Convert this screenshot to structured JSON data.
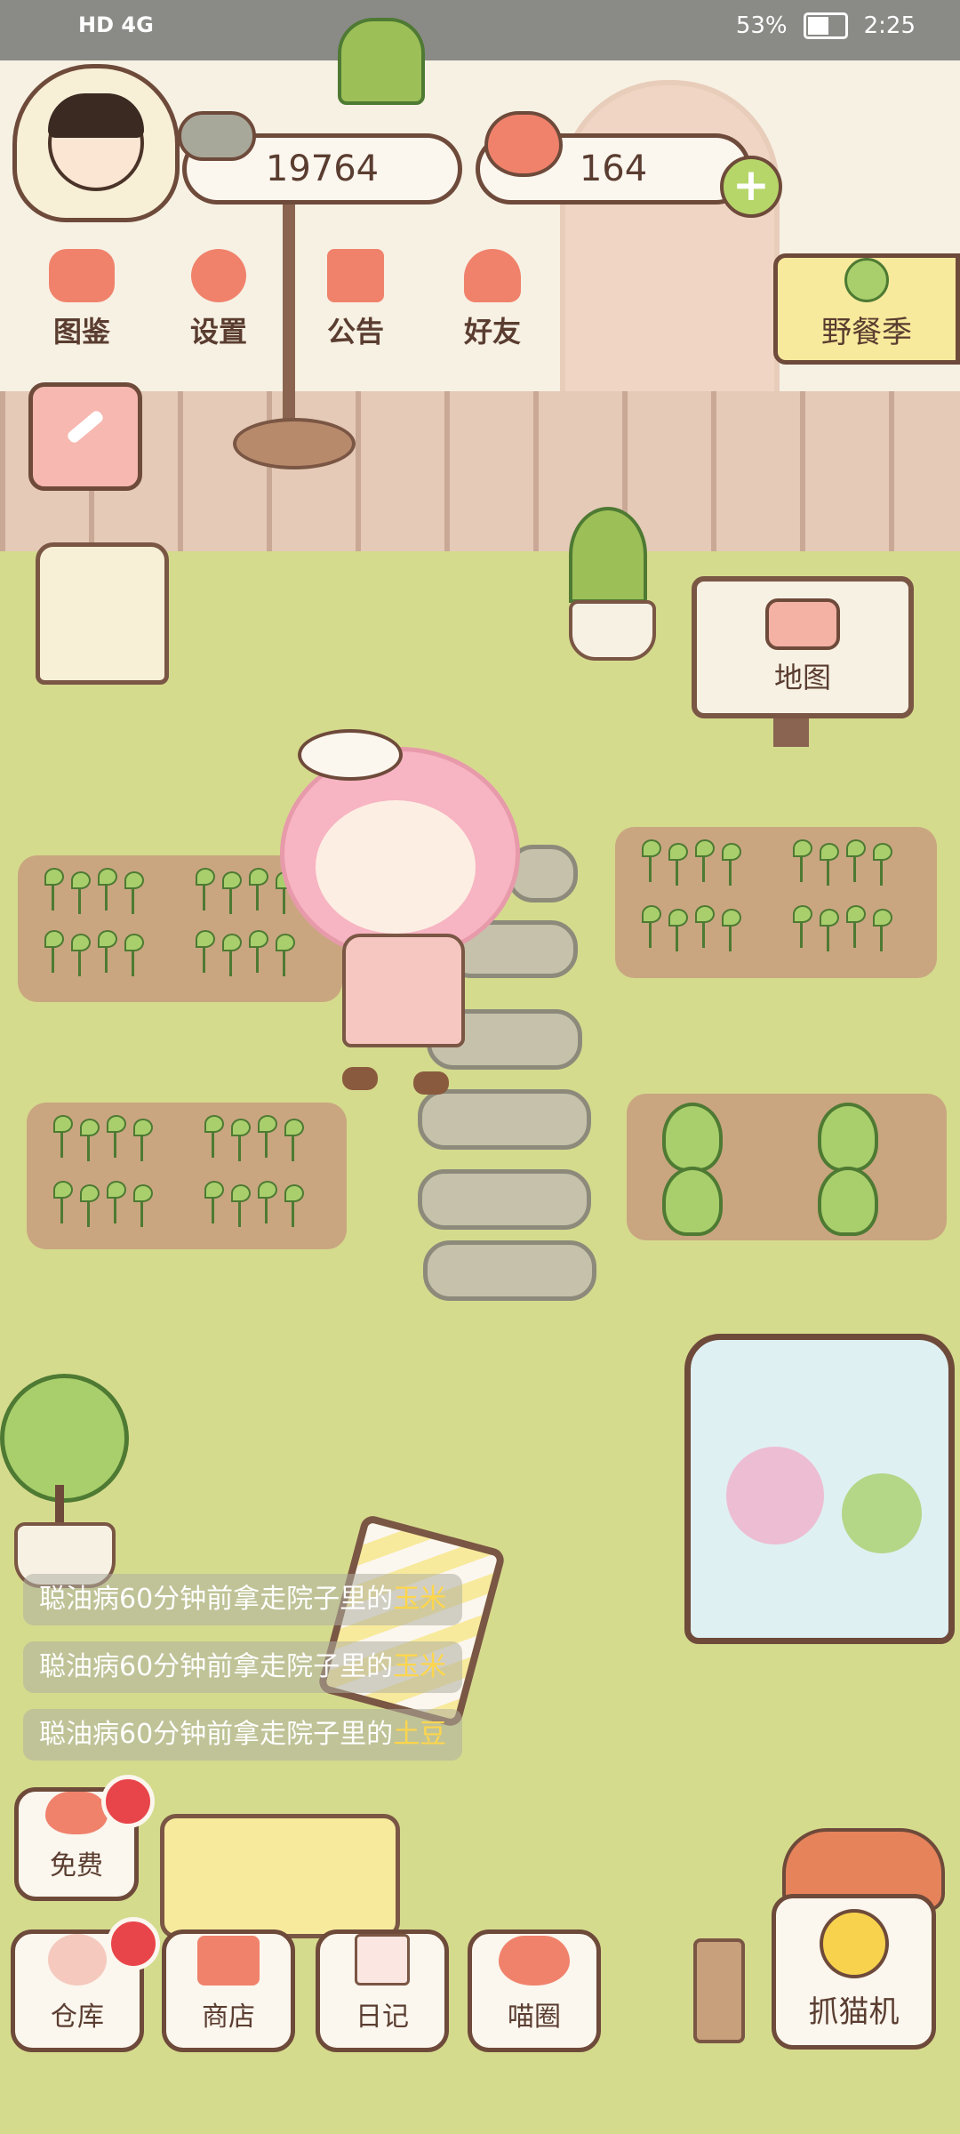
{
  "status_bar": {
    "left": "HD 4G",
    "battery": "53%",
    "battery_level": 0.53,
    "time": "2:25"
  },
  "resources": {
    "fish_count": "19764",
    "heart_count": "164"
  },
  "menu": [
    {
      "label": "图鉴",
      "icon": "cat-book-icon"
    },
    {
      "label": "设置",
      "icon": "gear-icon"
    },
    {
      "label": "公告",
      "icon": "gift-icon"
    },
    {
      "label": "好友",
      "icon": "friends-icon"
    }
  ],
  "event_banner": {
    "label": "野餐季"
  },
  "map_sign": {
    "label": "地图"
  },
  "messages": [
    {
      "text": "聪油病60分钟前拿走院子里的",
      "item": "玉米"
    },
    {
      "text": "聪油病60分钟前拿走院子里的",
      "item": "玉米"
    },
    {
      "text": "聪油病60分钟前拿走院子里的",
      "item": "土豆"
    }
  ],
  "free_button": {
    "label": "免费"
  },
  "bottom_bar": [
    {
      "label": "仓库",
      "icon": "storage-icon"
    },
    {
      "label": "商店",
      "icon": "shop-icon"
    },
    {
      "label": "日记",
      "icon": "diary-icon"
    },
    {
      "label": "喵圈",
      "icon": "cat-planet-icon"
    }
  ],
  "claw_machine": {
    "label": "抓猫机"
  },
  "colors": {
    "grass": "#d5db8d",
    "accent": "#f0826c",
    "border": "#6e4a3a",
    "badge": "#e8454a"
  }
}
